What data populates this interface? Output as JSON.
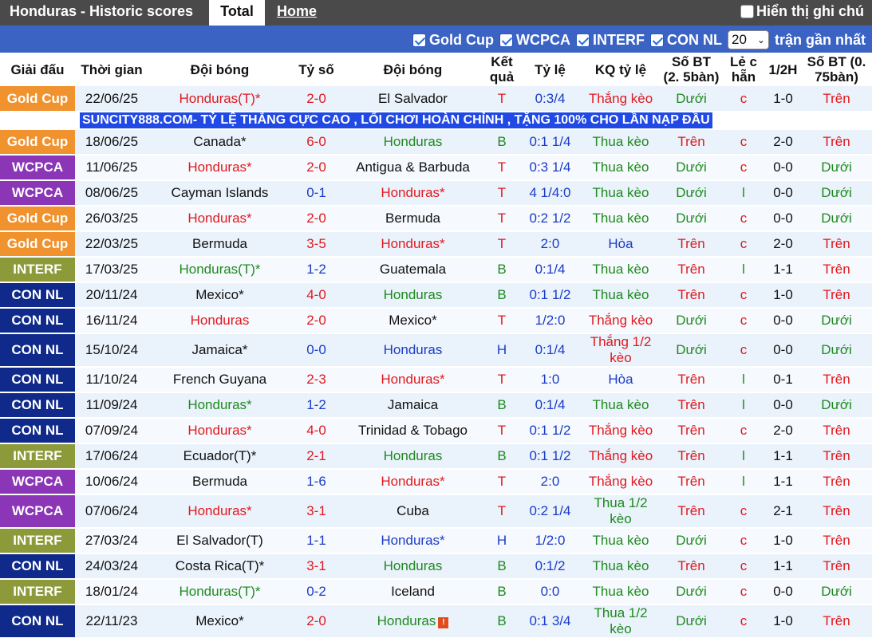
{
  "topbar": {
    "title": "Honduras - Historic scores",
    "tab_total": "Total",
    "tab_home": "Home",
    "notes_label": "Hiển thị ghi chú"
  },
  "filters": {
    "items": [
      {
        "label": "Gold Cup"
      },
      {
        "label": "WCPCA"
      },
      {
        "label": "INTERF"
      },
      {
        "label": "CON NL"
      }
    ],
    "count_value": "20",
    "recent_label": "trận gần nhất"
  },
  "colors": {
    "Gold Cup": "#f0922e",
    "WCPCA": "#8a36b6",
    "INTERF": "#8c9a3a",
    "CON NL": "#0f2a8a"
  },
  "headers": [
    "Giải đấu",
    "Thời gian",
    "Đội bóng",
    "Tỷ số",
    "Đội bóng",
    "Kết quả",
    "Tỷ lệ",
    "KQ tỷ lệ",
    "Số BT (2. 5bàn)",
    "Lẻ c hẵn",
    "1/2H",
    "Số BT (0. 75bàn)"
  ],
  "ad_text": "SUNCITY888.COM- TỶ LỆ THẮNG CỰC CAO , LỐI CHƠI HOÀN CHỈNH , TẶNG 100% CHO LẦN NẠP ĐẦU",
  "rows": [
    {
      "league": "Gold Cup",
      "date": "22/06/25",
      "home": "Honduras(T)*",
      "home_c": "red",
      "score": "2-0",
      "score_c": "red",
      "away": "El Salvador",
      "away_c": "",
      "res": "T",
      "res_c": "red",
      "odds": "0:3/4",
      "odds_c": "blue",
      "kq": "Thắng kèo",
      "kq_c": "red",
      "ou": "Dưới",
      "ou_c": "green",
      "oe": "c",
      "oe_c": "red",
      "half": "1-0",
      "ou2": "Trên",
      "ou2_c": "red",
      "tall": false
    },
    {
      "ad": true
    },
    {
      "league": "Gold Cup",
      "date": "18/06/25",
      "home": "Canada*",
      "home_c": "",
      "score": "6-0",
      "score_c": "red",
      "away": "Honduras",
      "away_c": "green",
      "res": "B",
      "res_c": "green",
      "odds": "0:1 1/4",
      "odds_c": "blue",
      "kq": "Thua kèo",
      "kq_c": "green",
      "ou": "Trên",
      "ou_c": "red",
      "oe": "c",
      "oe_c": "red",
      "half": "2-0",
      "ou2": "Trên",
      "ou2_c": "red",
      "tall": false
    },
    {
      "league": "WCPCA",
      "date": "11/06/25",
      "home": "Honduras*",
      "home_c": "red",
      "score": "2-0",
      "score_c": "red",
      "away": "Antigua & Barbuda",
      "away_c": "",
      "res": "T",
      "res_c": "red",
      "odds": "0:3 1/4",
      "odds_c": "blue",
      "kq": "Thua kèo",
      "kq_c": "green",
      "ou": "Dưới",
      "ou_c": "green",
      "oe": "c",
      "oe_c": "red",
      "half": "0-0",
      "ou2": "Dưới",
      "ou2_c": "green",
      "tall": false
    },
    {
      "league": "WCPCA",
      "date": "08/06/25",
      "home": "Cayman Islands",
      "home_c": "",
      "score": "0-1",
      "score_c": "blue",
      "away": "Honduras*",
      "away_c": "red",
      "res": "T",
      "res_c": "red",
      "odds": "4 1/4:0",
      "odds_c": "blue",
      "kq": "Thua kèo",
      "kq_c": "green",
      "ou": "Dưới",
      "ou_c": "green",
      "oe": "l",
      "oe_c": "green",
      "half": "0-0",
      "ou2": "Dưới",
      "ou2_c": "green",
      "tall": false
    },
    {
      "league": "Gold Cup",
      "date": "26/03/25",
      "home": "Honduras*",
      "home_c": "red",
      "score": "2-0",
      "score_c": "red",
      "away": "Bermuda",
      "away_c": "",
      "res": "T",
      "res_c": "red",
      "odds": "0:2 1/2",
      "odds_c": "blue",
      "kq": "Thua kèo",
      "kq_c": "green",
      "ou": "Dưới",
      "ou_c": "green",
      "oe": "c",
      "oe_c": "red",
      "half": "0-0",
      "ou2": "Dưới",
      "ou2_c": "green",
      "tall": false
    },
    {
      "league": "Gold Cup",
      "date": "22/03/25",
      "home": "Bermuda",
      "home_c": "",
      "score": "3-5",
      "score_c": "red",
      "away": "Honduras*",
      "away_c": "red",
      "res": "T",
      "res_c": "red",
      "odds": "2:0",
      "odds_c": "blue",
      "kq": "Hòa",
      "kq_c": "blue",
      "ou": "Trên",
      "ou_c": "red",
      "oe": "c",
      "oe_c": "red",
      "half": "2-0",
      "ou2": "Trên",
      "ou2_c": "red",
      "tall": false
    },
    {
      "league": "INTERF",
      "date": "17/03/25",
      "home": "Honduras(T)*",
      "home_c": "green",
      "score": "1-2",
      "score_c": "blue",
      "away": "Guatemala",
      "away_c": "",
      "res": "B",
      "res_c": "green",
      "odds": "0:1/4",
      "odds_c": "blue",
      "kq": "Thua kèo",
      "kq_c": "green",
      "ou": "Trên",
      "ou_c": "red",
      "oe": "l",
      "oe_c": "green",
      "half": "1-1",
      "ou2": "Trên",
      "ou2_c": "red",
      "tall": false
    },
    {
      "league": "CON NL",
      "date": "20/11/24",
      "home": "Mexico*",
      "home_c": "",
      "score": "4-0",
      "score_c": "red",
      "away": "Honduras",
      "away_c": "green",
      "res": "B",
      "res_c": "green",
      "odds": "0:1 1/2",
      "odds_c": "blue",
      "kq": "Thua kèo",
      "kq_c": "green",
      "ou": "Trên",
      "ou_c": "red",
      "oe": "c",
      "oe_c": "red",
      "half": "1-0",
      "ou2": "Trên",
      "ou2_c": "red",
      "tall": false
    },
    {
      "league": "CON NL",
      "date": "16/11/24",
      "home": "Honduras",
      "home_c": "red",
      "score": "2-0",
      "score_c": "red",
      "away": "Mexico*",
      "away_c": "",
      "res": "T",
      "res_c": "red",
      "odds": "1/2:0",
      "odds_c": "blue",
      "kq": "Thắng kèo",
      "kq_c": "red",
      "ou": "Dưới",
      "ou_c": "green",
      "oe": "c",
      "oe_c": "red",
      "half": "0-0",
      "ou2": "Dưới",
      "ou2_c": "green",
      "tall": false
    },
    {
      "league": "CON NL",
      "date": "15/10/24",
      "home": "Jamaica*",
      "home_c": "",
      "score": "0-0",
      "score_c": "blue",
      "away": "Honduras",
      "away_c": "blue",
      "res": "H",
      "res_c": "blue",
      "odds": "0:1/4",
      "odds_c": "blue",
      "kq": "Thắng 1/2 kèo",
      "kq_c": "red",
      "ou": "Dưới",
      "ou_c": "green",
      "oe": "c",
      "oe_c": "red",
      "half": "0-0",
      "ou2": "Dưới",
      "ou2_c": "green",
      "tall": true
    },
    {
      "league": "CON NL",
      "date": "11/10/24",
      "home": "French Guyana",
      "home_c": "",
      "score": "2-3",
      "score_c": "red",
      "away": "Honduras*",
      "away_c": "red",
      "res": "T",
      "res_c": "red",
      "odds": "1:0",
      "odds_c": "blue",
      "kq": "Hòa",
      "kq_c": "blue",
      "ou": "Trên",
      "ou_c": "red",
      "oe": "l",
      "oe_c": "green",
      "half": "0-1",
      "ou2": "Trên",
      "ou2_c": "red",
      "tall": false
    },
    {
      "league": "CON NL",
      "date": "11/09/24",
      "home": "Honduras*",
      "home_c": "green",
      "score": "1-2",
      "score_c": "blue",
      "away": "Jamaica",
      "away_c": "",
      "res": "B",
      "res_c": "green",
      "odds": "0:1/4",
      "odds_c": "blue",
      "kq": "Thua kèo",
      "kq_c": "green",
      "ou": "Trên",
      "ou_c": "red",
      "oe": "l",
      "oe_c": "green",
      "half": "0-0",
      "ou2": "Dưới",
      "ou2_c": "green",
      "tall": false
    },
    {
      "league": "CON NL",
      "date": "07/09/24",
      "home": "Honduras*",
      "home_c": "red",
      "score": "4-0",
      "score_c": "red",
      "away": "Trinidad & Tobago",
      "away_c": "",
      "res": "T",
      "res_c": "red",
      "odds": "0:1 1/2",
      "odds_c": "blue",
      "kq": "Thắng kèo",
      "kq_c": "red",
      "ou": "Trên",
      "ou_c": "red",
      "oe": "c",
      "oe_c": "red",
      "half": "2-0",
      "ou2": "Trên",
      "ou2_c": "red",
      "tall": false
    },
    {
      "league": "INTERF",
      "date": "17/06/24",
      "home": "Ecuador(T)*",
      "home_c": "",
      "score": "2-1",
      "score_c": "red",
      "away": "Honduras",
      "away_c": "green",
      "res": "B",
      "res_c": "green",
      "odds": "0:1 1/2",
      "odds_c": "blue",
      "kq": "Thắng kèo",
      "kq_c": "red",
      "ou": "Trên",
      "ou_c": "red",
      "oe": "l",
      "oe_c": "green",
      "half": "1-1",
      "ou2": "Trên",
      "ou2_c": "red",
      "tall": false
    },
    {
      "league": "WCPCA",
      "date": "10/06/24",
      "home": "Bermuda",
      "home_c": "",
      "score": "1-6",
      "score_c": "blue",
      "away": "Honduras*",
      "away_c": "red",
      "res": "T",
      "res_c": "red",
      "odds": "2:0",
      "odds_c": "blue",
      "kq": "Thắng kèo",
      "kq_c": "red",
      "ou": "Trên",
      "ou_c": "red",
      "oe": "l",
      "oe_c": "green",
      "half": "1-1",
      "ou2": "Trên",
      "ou2_c": "red",
      "tall": false
    },
    {
      "league": "WCPCA",
      "date": "07/06/24",
      "home": "Honduras*",
      "home_c": "red",
      "score": "3-1",
      "score_c": "red",
      "away": "Cuba",
      "away_c": "",
      "res": "T",
      "res_c": "red",
      "odds": "0:2 1/4",
      "odds_c": "blue",
      "kq": "Thua 1/2 kèo",
      "kq_c": "green",
      "ou": "Trên",
      "ou_c": "red",
      "oe": "c",
      "oe_c": "red",
      "half": "2-1",
      "ou2": "Trên",
      "ou2_c": "red",
      "tall": true
    },
    {
      "league": "INTERF",
      "date": "27/03/24",
      "home": "El Salvador(T)",
      "home_c": "",
      "score": "1-1",
      "score_c": "blue",
      "away": "Honduras*",
      "away_c": "blue",
      "res": "H",
      "res_c": "blue",
      "odds": "1/2:0",
      "odds_c": "blue",
      "kq": "Thua kèo",
      "kq_c": "green",
      "ou": "Dưới",
      "ou_c": "green",
      "oe": "c",
      "oe_c": "red",
      "half": "1-0",
      "ou2": "Trên",
      "ou2_c": "red",
      "tall": false
    },
    {
      "league": "CON NL",
      "date": "24/03/24",
      "home": "Costa Rica(T)*",
      "home_c": "",
      "score": "3-1",
      "score_c": "red",
      "away": "Honduras",
      "away_c": "green",
      "res": "B",
      "res_c": "green",
      "odds": "0:1/2",
      "odds_c": "blue",
      "kq": "Thua kèo",
      "kq_c": "green",
      "ou": "Trên",
      "ou_c": "red",
      "oe": "c",
      "oe_c": "red",
      "half": "1-1",
      "ou2": "Trên",
      "ou2_c": "red",
      "tall": false
    },
    {
      "league": "INTERF",
      "date": "18/01/24",
      "home": "Honduras(T)*",
      "home_c": "green",
      "score": "0-2",
      "score_c": "blue",
      "away": "Iceland",
      "away_c": "",
      "res": "B",
      "res_c": "green",
      "odds": "0:0",
      "odds_c": "blue",
      "kq": "Thua kèo",
      "kq_c": "green",
      "ou": "Dưới",
      "ou_c": "green",
      "oe": "c",
      "oe_c": "red",
      "half": "0-0",
      "ou2": "Dưới",
      "ou2_c": "green",
      "tall": false
    },
    {
      "league": "CON NL",
      "date": "22/11/23",
      "home": "Mexico*",
      "home_c": "",
      "score": "2-0",
      "score_c": "red",
      "away": "Honduras",
      "away_c": "green",
      "away_flag": true,
      "res": "B",
      "res_c": "green",
      "odds": "0:1 3/4",
      "odds_c": "blue",
      "kq": "Thua 1/2 kèo",
      "kq_c": "green",
      "ou": "Dưới",
      "ou_c": "green",
      "oe": "c",
      "oe_c": "red",
      "half": "1-0",
      "ou2": "Trên",
      "ou2_c": "red",
      "tall": true
    }
  ]
}
